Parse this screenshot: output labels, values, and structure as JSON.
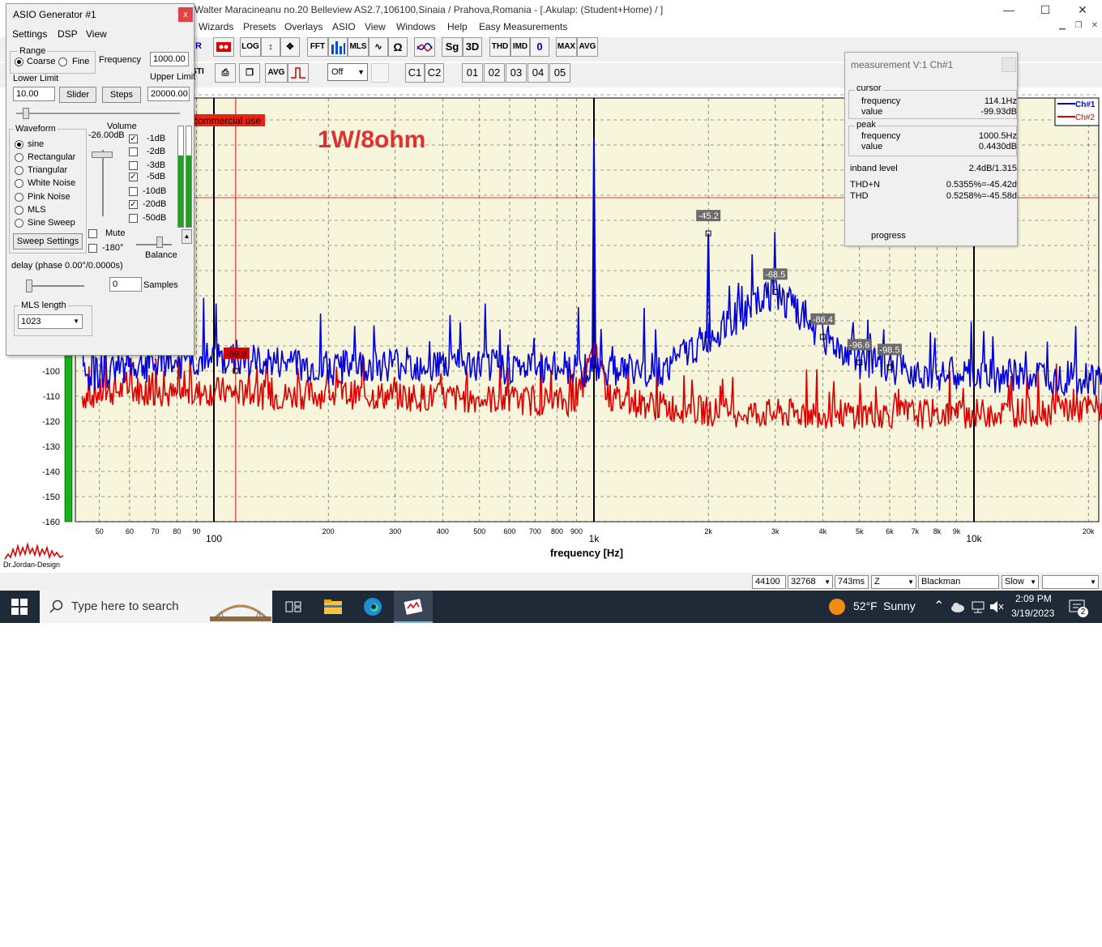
{
  "window": {
    "title": "Walter Maracineanu no.20 Belleview AS2.7,106100,Sinaia / Prahova,Romania - [.Akulap: (Student+Home) / ]",
    "min_label": "—",
    "max_label": "☐",
    "close_label": "✕"
  },
  "menu": [
    "Wizards",
    "Presets",
    "Overlays",
    "ASIO",
    "View",
    "Windows",
    "Help",
    "Easy Measurements"
  ],
  "toolbar1": [
    "R",
    "LOG",
    "FFT",
    "MLS",
    "Sg",
    "3D",
    "THD",
    "IMD",
    "0",
    "MAX",
    "AVG"
  ],
  "toolbar2": {
    "sti": "STI",
    "avg": "AVG",
    "select": "Off",
    "c1": "C1",
    "c2": "C2",
    "mem": [
      "01",
      "02",
      "03",
      "04",
      "05"
    ]
  },
  "generator": {
    "title": "ASIO Generator #1",
    "close": "x",
    "menu": [
      "Settings",
      "DSP",
      "View"
    ],
    "range_label": "Range",
    "coarse": "Coarse",
    "fine": "Fine",
    "frequency_label": "Frequency",
    "frequency": "1000.00",
    "lower_label": "Lower Limit",
    "lower": "10.00",
    "upper_label": "Upper Limit",
    "upper": "20000.00",
    "slider_btn": "Slider",
    "steps_btn": "Steps",
    "waveform_label": "Waveform",
    "waveforms": [
      "sine",
      "Rectangular",
      "Triangular",
      "White Noise",
      "Pink Noise",
      "MLS",
      "Sine Sweep"
    ],
    "volume_label": "Volume",
    "volume_db": "-26.00dB",
    "attenuators": [
      {
        "label": "-1dB",
        "checked": true
      },
      {
        "label": "-2dB",
        "checked": false
      },
      {
        "label": "-3dB",
        "checked": false
      },
      {
        "label": "-5dB",
        "checked": true
      },
      {
        "label": "-10dB",
        "checked": false
      },
      {
        "label": "-20dB",
        "checked": true
      },
      {
        "label": "-50dB",
        "checked": false
      }
    ],
    "sweep_btn": "Sweep Settings",
    "mute": "Mute",
    "invert": "-180°",
    "balance": "Balance",
    "delay_label": "delay (phase  0.00°/0.0000s)",
    "samples_value": "0",
    "samples_label": "Samples",
    "mls_label": "MLS length",
    "mls_value": "1023"
  },
  "measurement": {
    "title": "measurement V:1 Ch#1",
    "cursor_label": "cursor",
    "cursor_freq_label": "frequency",
    "cursor_freq": "114.1Hz",
    "cursor_value_label": "value",
    "cursor_value": "-99.93dB",
    "peak_label": "peak",
    "peak_freq_label": "frequency",
    "peak_freq": "1000.5Hz",
    "peak_value_label": "value",
    "peak_value": "0.4430dB",
    "inband_label": "inband level",
    "inband": "2.4dB/1.315",
    "thdn_label": "THD+N",
    "thdn": "0.5355%=-45.42d",
    "thd_label": "THD",
    "thd": "0.5258%=-45.58d",
    "progress_label": "progress"
  },
  "graph": {
    "annotation": "1W/8ohm",
    "watermark": "commercial use",
    "legend": [
      "Ch#1",
      "Ch#2"
    ],
    "xlabel": "frequency [Hz]",
    "y_ticks": [
      "-100",
      "-110",
      "-120",
      "-130",
      "-140",
      "-150",
      "-160"
    ],
    "x_minor": [
      "50",
      "60",
      "70",
      "80",
      "90",
      "200",
      "300",
      "400",
      "500",
      "600",
      "700",
      "800",
      "900",
      "2k",
      "3k",
      "4k",
      "5k",
      "6k",
      "7k",
      "8k",
      "9k",
      "20k"
    ],
    "x_major": [
      "100",
      "1k",
      "10k"
    ],
    "markers": [
      "-45.2",
      "-68.5",
      "-86.4",
      "-96.6",
      "-98.5"
    ],
    "cursor_marker": "-99.9",
    "ch1_color": "#0000dd",
    "ch2_color": "#dd0000",
    "plot_bg": "#f7f5dc"
  },
  "chart_data": {
    "type": "line",
    "xlabel": "frequency [Hz]",
    "ylabel": "",
    "x_scale": "log",
    "xlim": [
      40,
      22000
    ],
    "ylim": [
      -160,
      10
    ],
    "grid": true,
    "legend_position": "top-right",
    "series": [
      {
        "name": "Ch#1",
        "x": [
          45,
          60,
          80,
          100,
          150,
          200,
          300,
          500,
          700,
          900,
          1000,
          1100,
          1500,
          2000,
          3000,
          4000,
          5000,
          6000,
          8000,
          10000,
          15000,
          20000
        ],
        "y": [
          -102,
          -98,
          -97,
          -95,
          -97,
          -99,
          -97,
          -98,
          -99,
          -99,
          0.44,
          -99,
          -100,
          -45.2,
          -68.5,
          -86.4,
          -96.6,
          -98.5,
          -101,
          -102,
          -102,
          -103
        ]
      },
      {
        "name": "Ch#2",
        "x": [
          45,
          60,
          80,
          100,
          150,
          200,
          300,
          500,
          700,
          900,
          1000,
          1100,
          1500,
          2000,
          3000,
          4000,
          5000,
          6000,
          8000,
          10000,
          15000,
          20000
        ],
        "y": [
          -110,
          -107,
          -110,
          -108,
          -110,
          -109,
          -110,
          -111,
          -112,
          -112,
          -92,
          -111,
          -114,
          -116,
          -117,
          -117,
          -117,
          -117,
          -117,
          -117,
          -116,
          -115
        ]
      }
    ],
    "annotations": [
      "1W/8ohm",
      "-45.2",
      "-68.5",
      "-86.4",
      "-96.6",
      "-98.5",
      "-99.9"
    ]
  },
  "status": {
    "sr": "44100",
    "fft": "32768",
    "time": "743ms",
    "mode": "Z",
    "window": "Blackman",
    "speed": "Slow",
    "extra": ""
  },
  "taskbar": {
    "search": "Type here to search",
    "temp": "52°F",
    "weather": "Sunny",
    "time": "2:09 PM",
    "date": "3/19/2023",
    "notif_count": "2"
  },
  "logo_text": "Dr.Jordan-Design"
}
